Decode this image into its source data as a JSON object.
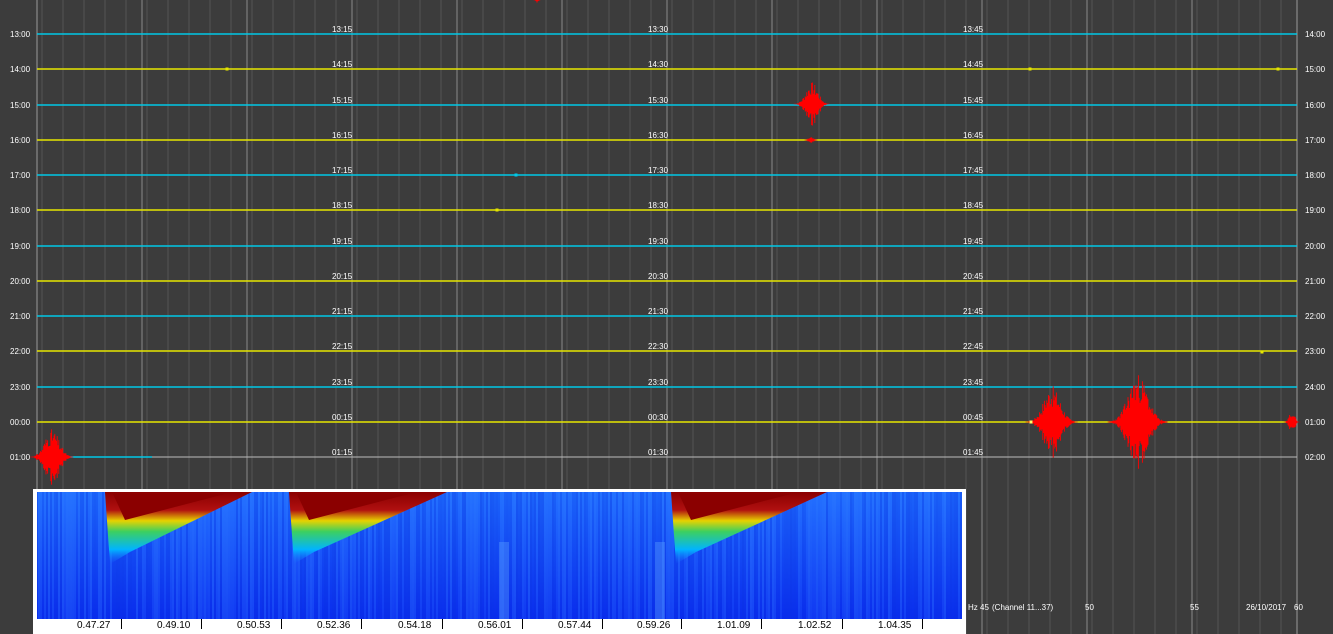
{
  "helicorder": {
    "left_labels": [
      "13:00",
      "14:00",
      "15:00",
      "16:00",
      "17:00",
      "18:00",
      "19:00",
      "20:00",
      "21:00",
      "22:00",
      "23:00",
      "00:00",
      "01:00"
    ],
    "right_labels": [
      "14:00",
      "15:00",
      "16:00",
      "17:00",
      "18:00",
      "19:00",
      "20:00",
      "21:00",
      "22:00",
      "23:00",
      "24:00",
      "01:00",
      "02:00"
    ],
    "mid_labels_15": [
      "13:15",
      "14:15",
      "15:15",
      "16:15",
      "17:15",
      "18:15",
      "19:15",
      "20:15",
      "21:15",
      "22:15",
      "23:15",
      "00:15",
      "01:15"
    ],
    "mid_labels_30": [
      "13:30",
      "14:30",
      "15:30",
      "16:30",
      "17:30",
      "18:30",
      "19:30",
      "20:30",
      "21:30",
      "22:30",
      "23:30",
      "00:30",
      "01:30"
    ],
    "mid_labels_45": [
      "13:45",
      "14:45",
      "15:45",
      "16:45",
      "17:45",
      "18:45",
      "19:45",
      "20:45",
      "21:45",
      "22:45",
      "23:45",
      "00:45",
      "01:45"
    ],
    "colors": {
      "background": "#3c3c3c",
      "trace_cyan": "#00c8e6",
      "trace_yellow": "#e6e600",
      "event_red": "#ff0000",
      "grid": "#8a8a8a"
    }
  },
  "spectrogram": {
    "time_ticks": [
      "0.47.27",
      "0.49.10",
      "0.50.53",
      "0.52.36",
      "0.54.18",
      "0.56.01",
      "0.57.44",
      "0.59.26",
      "1.01.09",
      "1.02.52",
      "1.04.35"
    ]
  },
  "bottom_bar": {
    "freq_ticks": [
      "45",
      "50",
      "55",
      "60"
    ],
    "hz_label": "Hz",
    "channel_label": "(Channel 11...37)",
    "date": "26/10/2017"
  }
}
